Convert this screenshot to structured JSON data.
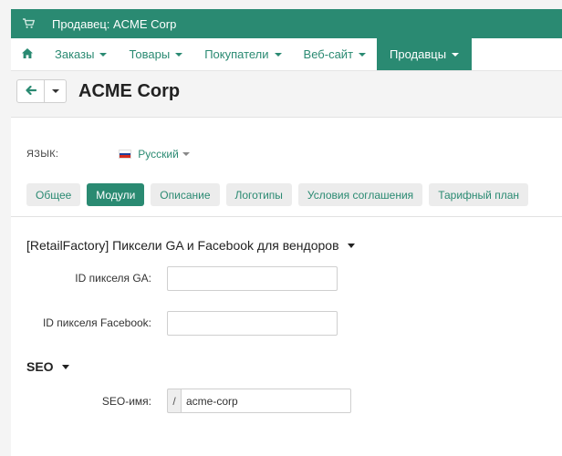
{
  "topbar": {
    "title": "Продавец: ACME Corp",
    "icon": "cart-icon"
  },
  "nav": {
    "home_icon": "home-icon",
    "items": [
      {
        "label": "Заказы"
      },
      {
        "label": "Товары"
      },
      {
        "label": "Покупатели"
      },
      {
        "label": "Веб-сайт"
      },
      {
        "label": "Продавцы",
        "active": true
      }
    ]
  },
  "header": {
    "title": "ACME Corp",
    "back_icon": "arrow-left-icon"
  },
  "language": {
    "label": "ЯЗЫК:",
    "selected": "Русский"
  },
  "tabs": [
    {
      "label": "Общее"
    },
    {
      "label": "Модули",
      "active": true
    },
    {
      "label": "Описание"
    },
    {
      "label": "Логотипы"
    },
    {
      "label": "Условия соглашения"
    },
    {
      "label": "Тарифный план"
    }
  ],
  "pixels_section": {
    "title": "[RetailFactory] Пиксели GA и Facebook для вендоров",
    "ga_label": "ID пикселя GA:",
    "ga_value": "",
    "fb_label": "ID пикселя Facebook:",
    "fb_value": ""
  },
  "seo_section": {
    "title": "SEO",
    "name_label": "SEO-имя:",
    "prefix": "/",
    "value": "acme-corp"
  },
  "colors": {
    "accent": "#2a8a72",
    "tab_bg": "#ececec"
  }
}
